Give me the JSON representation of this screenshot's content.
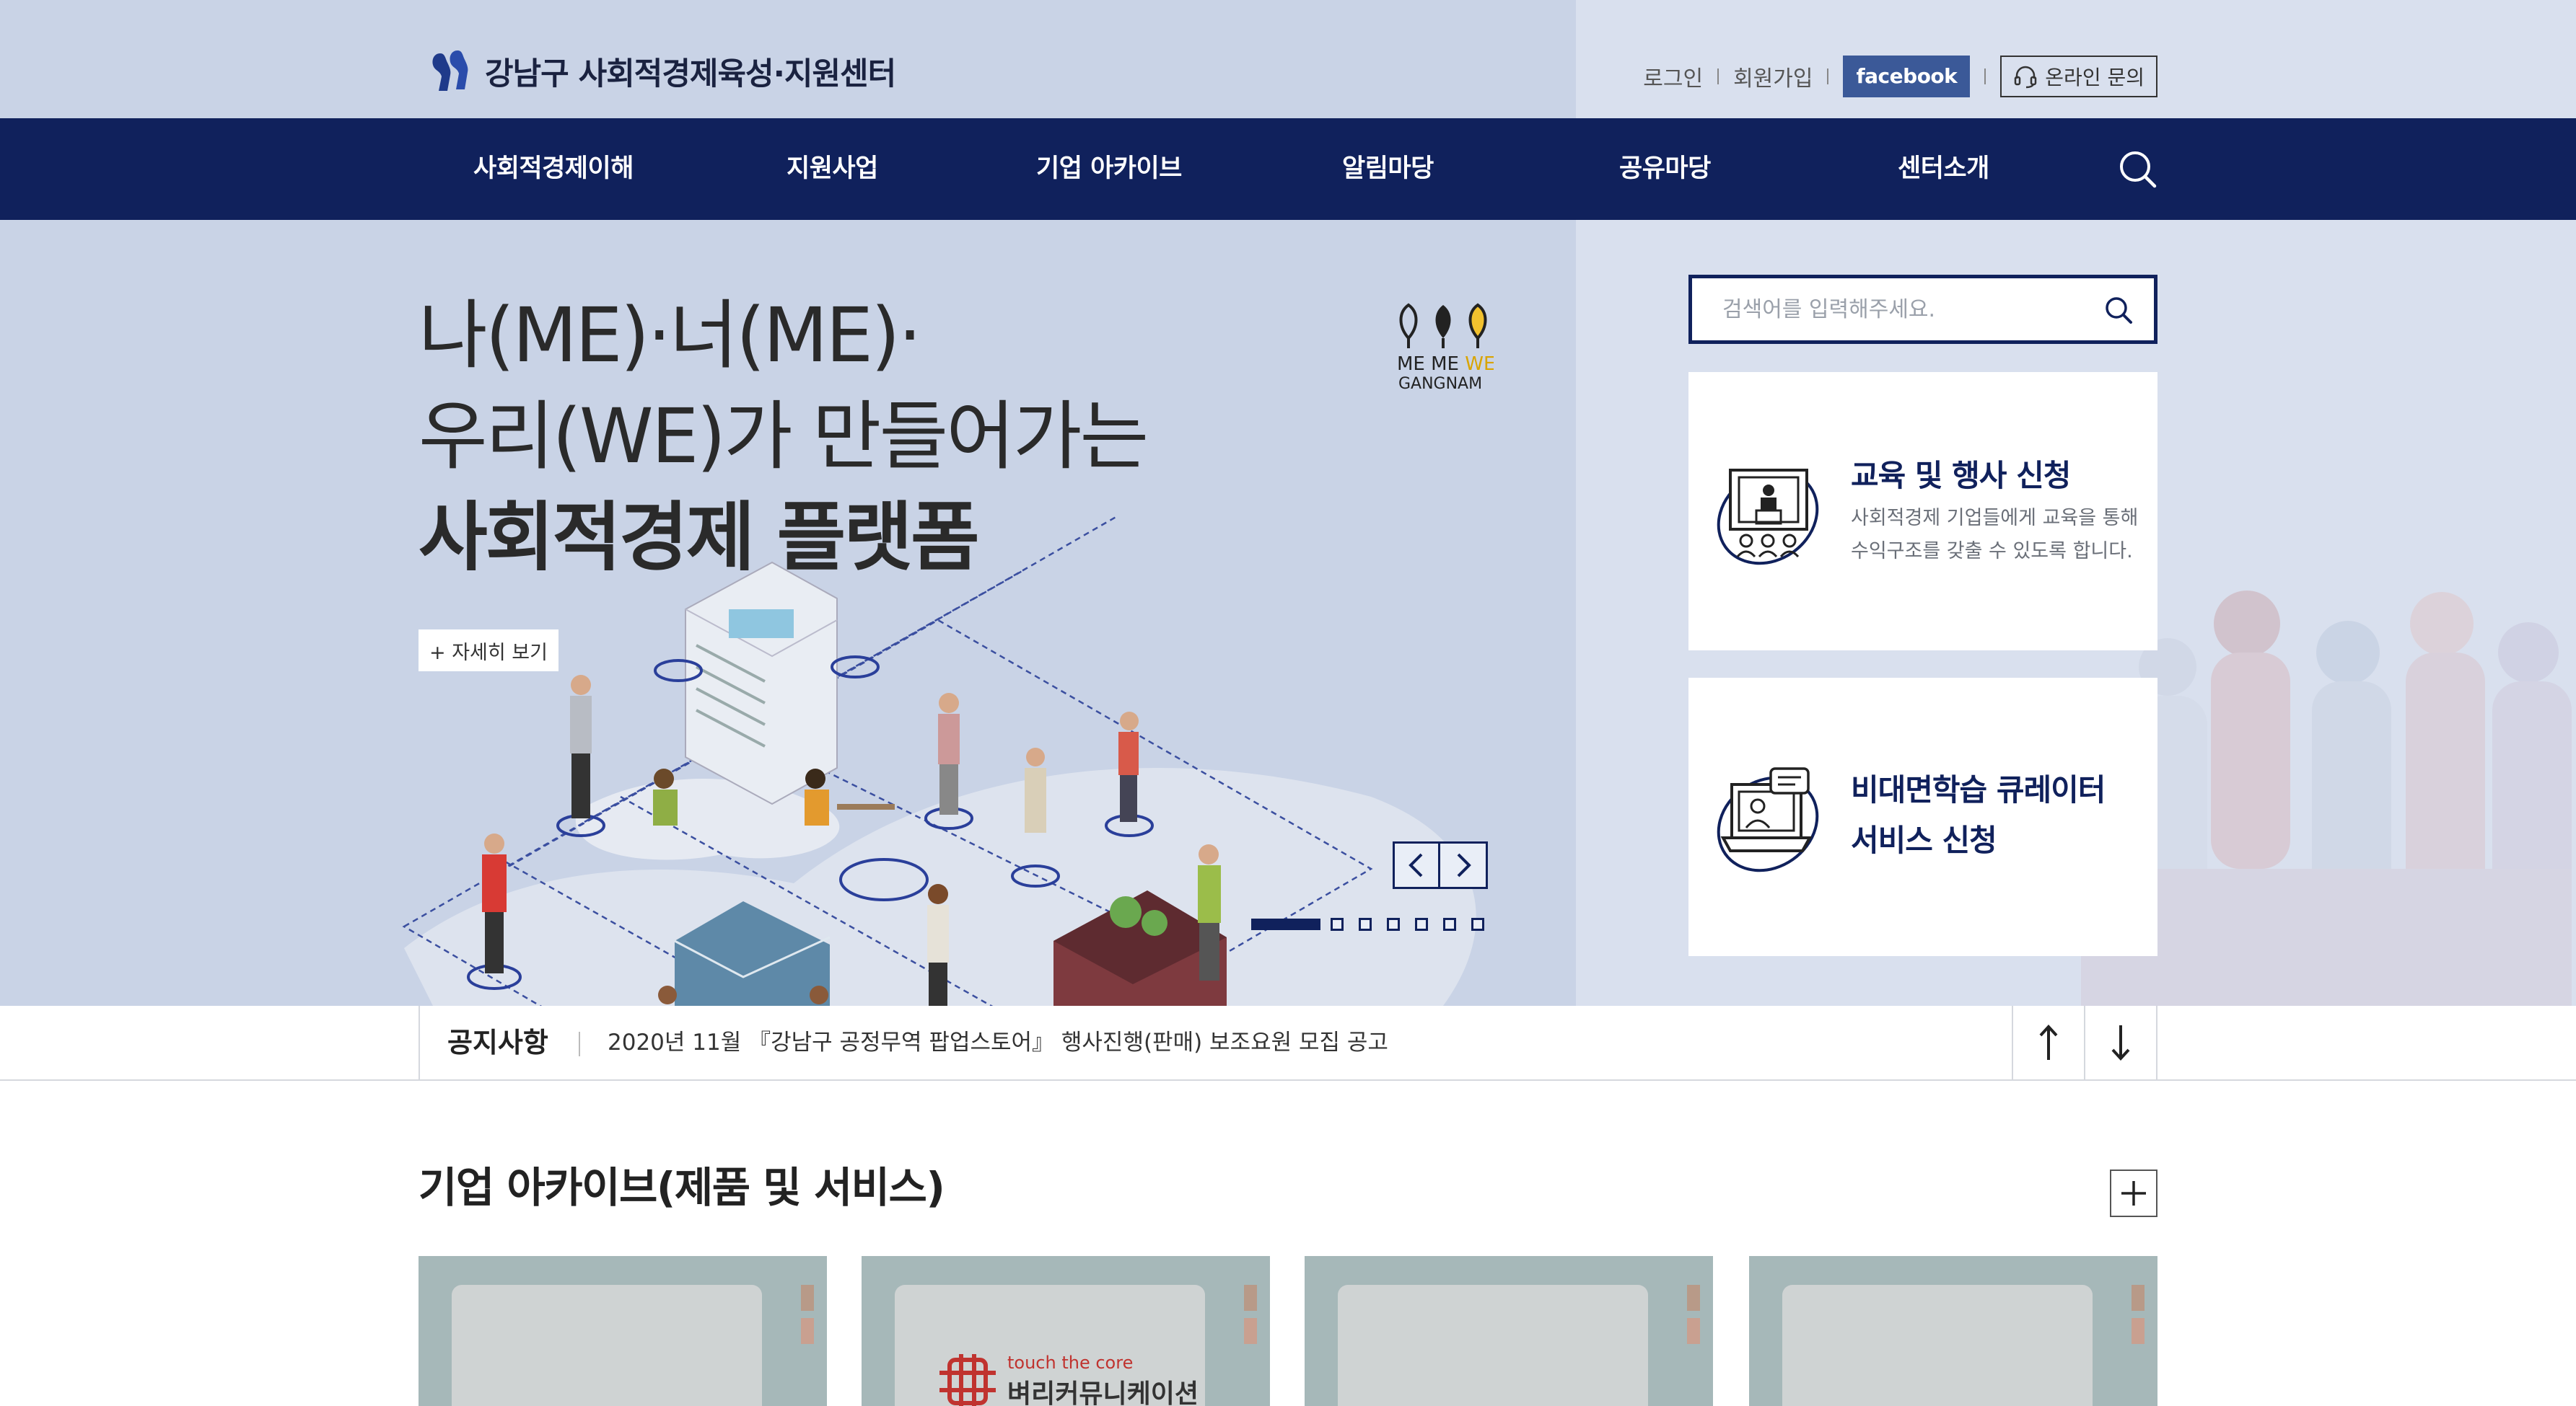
{
  "header": {
    "logo_text": "강남구 사회적경제육성·지원센터",
    "login": "로그인",
    "signup": "회원가입",
    "facebook": "facebook",
    "online_inquiry": "온라인 문의"
  },
  "nav": {
    "items": [
      "사회적경제이해",
      "지원사업",
      "기업 아카이브",
      "알림마당",
      "공유마당",
      "센터소개"
    ]
  },
  "hero": {
    "line1": "나(ME)·너(ME)·",
    "line2": "우리(WE)가 만들어가는",
    "line3": "사회적경제 플랫폼",
    "more_button": "+ 자세히 보기",
    "brand_logo": {
      "line1a": "ME ME ",
      "line1b": "WE",
      "line2": "GANGNAM"
    },
    "slide_count": 6
  },
  "search": {
    "placeholder": "검색어를 입력해주세요."
  },
  "cards": [
    {
      "title": "교육 및 행사 신청",
      "desc1": "사회적경제 기업들에게 교육을 통해",
      "desc2": "수익구조를 갖출 수 있도록 합니다."
    },
    {
      "title1": "비대면학습 큐레이터",
      "title2": "서비스 신청"
    }
  ],
  "notice": {
    "label": "공지사항",
    "text": "2020년 11월 『강남구 공정무역 팝업스토어』 행사진행(판매) 보조요원 모집 공고"
  },
  "archive": {
    "title": "기업 아카이브(제품 및 서비스)",
    "thumb2_small": "touch the core",
    "thumb2_big": "벼리커뮤니케이션"
  },
  "colors": {
    "navy": "#10215c",
    "hero_bg": "#c9d3e6",
    "side_bg": "#d9e0ee",
    "facebook": "#3b5998"
  }
}
